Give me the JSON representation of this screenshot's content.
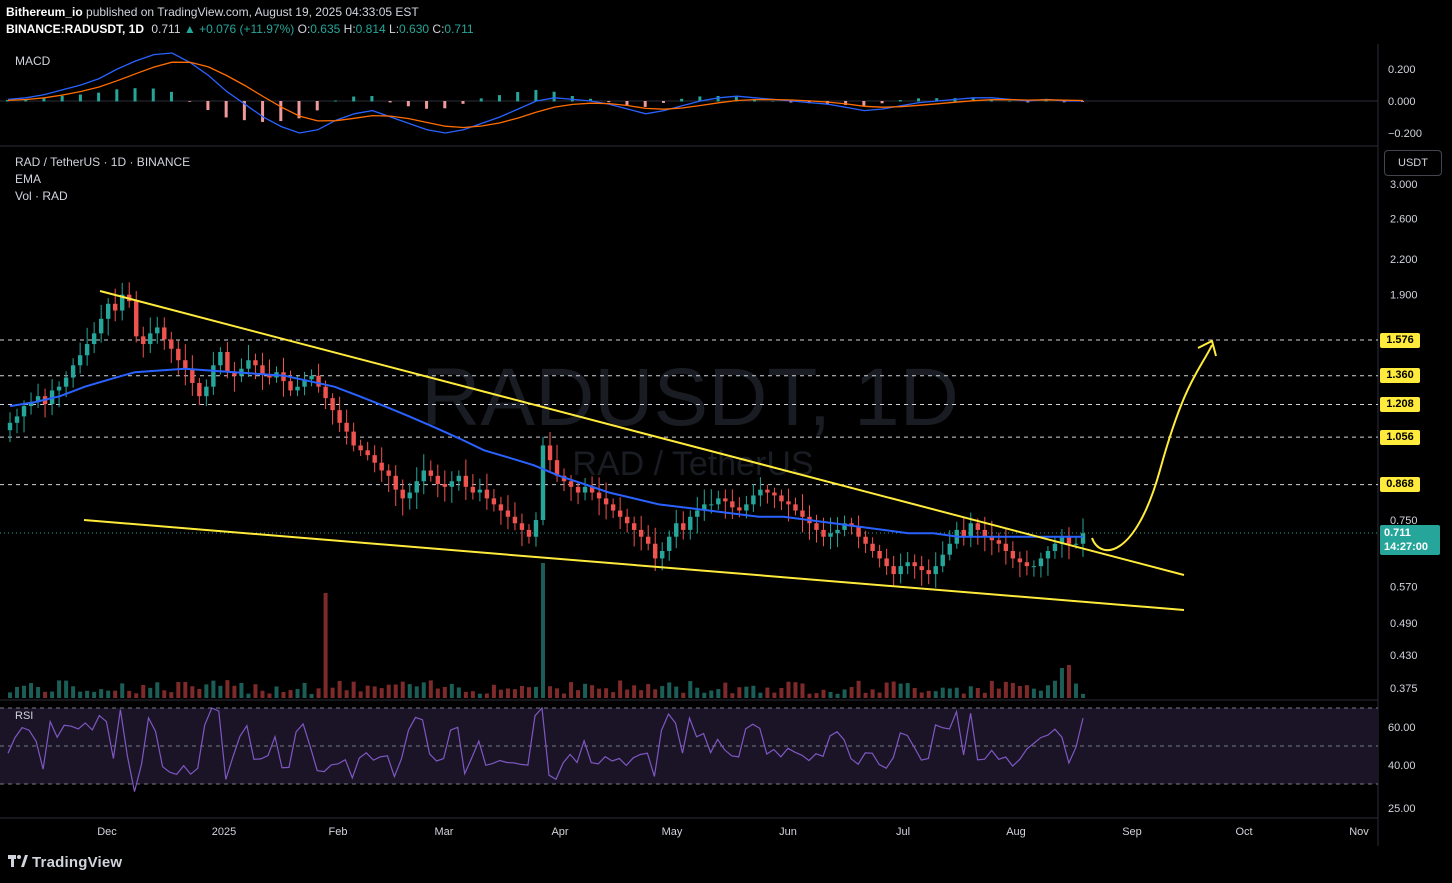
{
  "header": {
    "author": "Bithereum_io",
    "published_text": "published on TradingView.com, August 19, 2025 04:33:05 EST",
    "symbol": "BINANCE:RADUSDT, 1D",
    "last": "0.711",
    "change": "+0.076 (+11.97%)",
    "o_label": "O:",
    "o": "0.635",
    "h_label": "H:",
    "h": "0.814",
    "l_label": "L:",
    "l": "0.630",
    "c_label": "C:",
    "c": "0.711"
  },
  "panes": {
    "macd_label": "MACD",
    "main_title": "RAD / TetherUS · 1D · BINANCE",
    "ema_label": "EMA",
    "vol_label": "Vol · RAD",
    "rsi_label": "RSI",
    "watermark_symbol": "RADUSDT, 1D",
    "watermark_name": "RAD / TetherUS"
  },
  "currency_button": "USDT",
  "last_price_tag": {
    "price": "0.711",
    "countdown": "14:27:00"
  },
  "footer": {
    "logo": "TradingView"
  },
  "colors": {
    "up": "#26a69a",
    "down": "#ef5350",
    "ema": "#2962ff",
    "trendline": "#ffeb3b",
    "rsi": "#7e57c2",
    "macd_line": "#2962ff",
    "signal_line": "#ff6d00",
    "background": "#000000"
  },
  "chart_data": {
    "type": "candlestick",
    "symbol": "RADUSDT",
    "timeframe": "1D",
    "x_ticks": [
      "Dec",
      "2025",
      "Feb",
      "Mar",
      "Apr",
      "May",
      "Jun",
      "Jul",
      "Aug",
      "Sep",
      "Oct",
      "Nov"
    ],
    "price_ticks": [
      "3.000",
      "2.600",
      "2.200",
      "1.900",
      "1.576",
      "1.360",
      "1.208",
      "1.056",
      "0.868",
      "0.750",
      "0.570",
      "0.490",
      "0.430",
      "0.375"
    ],
    "price_scale": "log",
    "price_axis_labels": [
      "3.000",
      "2.600",
      "2.200",
      "1.900",
      "0.750",
      "0.570",
      "0.490",
      "0.430",
      "0.375"
    ],
    "horizontal_levels": [
      "1.576",
      "1.360",
      "1.208",
      "1.056",
      "0.868"
    ],
    "macd_ticks": [
      "0.200",
      "0.000",
      "−0.200"
    ],
    "rsi_ticks": [
      "60.00",
      "40.00",
      "25.00"
    ],
    "close_approx": [
      1.12,
      1.15,
      1.2,
      1.22,
      1.25,
      1.21,
      1.28,
      1.3,
      1.35,
      1.42,
      1.48,
      1.55,
      1.62,
      1.72,
      1.83,
      1.78,
      1.9,
      1.85,
      1.6,
      1.55,
      1.62,
      1.66,
      1.58,
      1.52,
      1.45,
      1.4,
      1.32,
      1.25,
      1.3,
      1.42,
      1.5,
      1.38,
      1.36,
      1.4,
      1.45,
      1.42,
      1.37,
      1.35,
      1.38,
      1.33,
      1.28,
      1.3,
      1.34,
      1.36,
      1.3,
      1.24,
      1.18,
      1.12,
      1.08,
      1.02,
      1.0,
      0.98,
      0.95,
      0.92,
      0.9,
      0.85,
      0.82,
      0.84,
      0.88,
      0.92,
      0.9,
      0.87,
      0.86,
      0.88,
      0.9,
      0.86,
      0.84,
      0.85,
      0.82,
      0.8,
      0.78,
      0.76,
      0.74,
      0.72,
      0.7,
      0.75,
      1.02,
      0.96,
      0.9,
      0.88,
      0.86,
      0.84,
      0.86,
      0.84,
      0.82,
      0.8,
      0.78,
      0.76,
      0.74,
      0.72,
      0.7,
      0.68,
      0.64,
      0.66,
      0.7,
      0.74,
      0.72,
      0.76,
      0.78,
      0.8,
      0.8,
      0.82,
      0.81,
      0.79,
      0.78,
      0.8,
      0.83,
      0.85,
      0.84,
      0.83,
      0.81,
      0.8,
      0.78,
      0.76,
      0.74,
      0.72,
      0.7,
      0.71,
      0.72,
      0.74,
      0.73,
      0.7,
      0.68,
      0.66,
      0.64,
      0.62,
      0.6,
      0.62,
      0.63,
      0.62,
      0.61,
      0.6,
      0.62,
      0.65,
      0.68,
      0.72,
      0.7,
      0.74,
      0.72,
      0.7,
      0.69,
      0.68,
      0.66,
      0.64,
      0.63,
      0.62,
      0.62,
      0.64,
      0.66,
      0.68,
      0.7,
      0.68,
      0.68,
      0.71
    ],
    "ema_approx": [
      1.2,
      1.22,
      1.25,
      1.3,
      1.34,
      1.38,
      1.39,
      1.4,
      1.39,
      1.38,
      1.37,
      1.36,
      1.33,
      1.3,
      1.25,
      1.2,
      1.15,
      1.1,
      1.05,
      1.0,
      0.97,
      0.94,
      0.9,
      0.87,
      0.84,
      0.82,
      0.8,
      0.79,
      0.78,
      0.77,
      0.76,
      0.76,
      0.75,
      0.74,
      0.73,
      0.72,
      0.71,
      0.71,
      0.7,
      0.7,
      0.7,
      0.7,
      0.7,
      0.7
    ],
    "trendlines": [
      {
        "name": "upper",
        "from": {
          "date": "late Nov 2024",
          "price": 1.9
        },
        "to": {
          "date": "mid Sep 2025",
          "price": 0.6
        }
      },
      {
        "name": "lower",
        "from": {
          "date": "mid Nov 2024",
          "price": 0.8
        },
        "to": {
          "date": "mid Sep 2025",
          "price": 0.54
        }
      }
    ],
    "projection_target": "1.576"
  }
}
